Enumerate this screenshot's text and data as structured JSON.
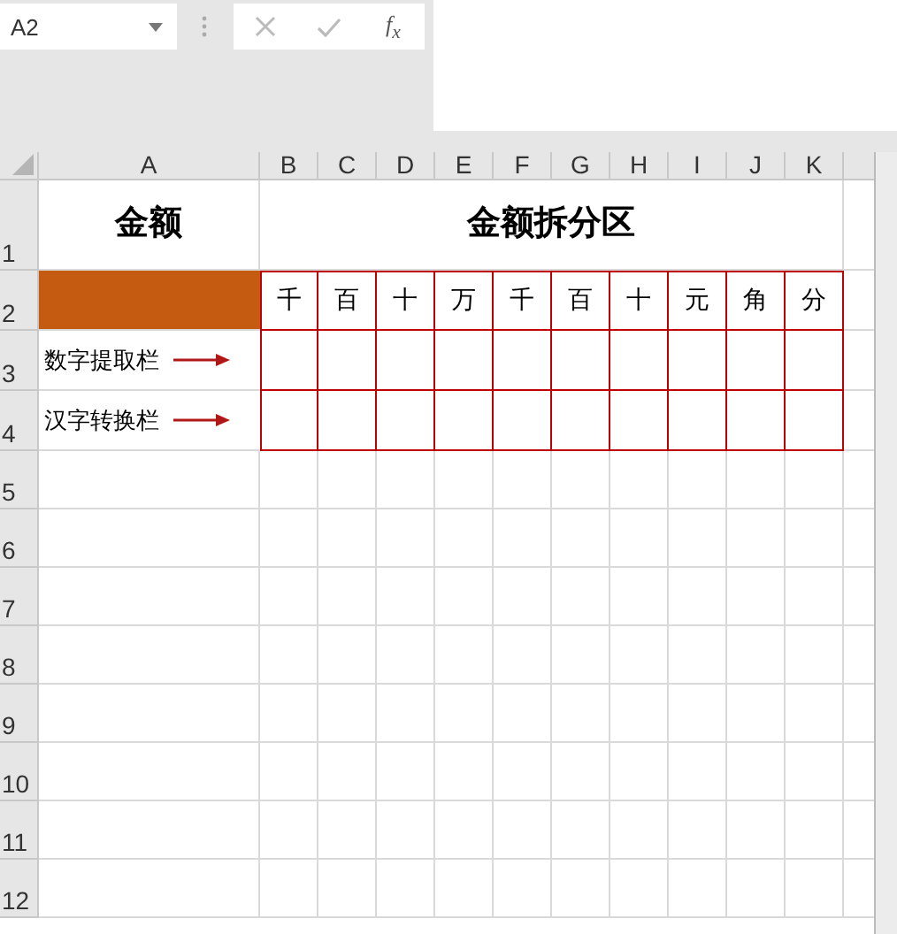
{
  "name_box": {
    "value": "A2"
  },
  "formula_bar": {
    "function_label": "f$_{x}$"
  },
  "sheet": {
    "columns": [
      "A",
      "B",
      "C",
      "D",
      "E",
      "F",
      "G",
      "H",
      "I",
      "J",
      "K"
    ],
    "row_numbers": [
      "1",
      "2",
      "3",
      "4",
      "5",
      "6",
      "7",
      "8",
      "9",
      "10",
      "11",
      "12"
    ],
    "amount_title": "金额",
    "split_title": "金额拆分区",
    "units": [
      "千",
      "百",
      "十",
      "万",
      "千",
      "百",
      "十",
      "元",
      "角",
      "分"
    ],
    "row_labels": [
      "数字提取栏",
      "汉字转换栏"
    ]
  }
}
